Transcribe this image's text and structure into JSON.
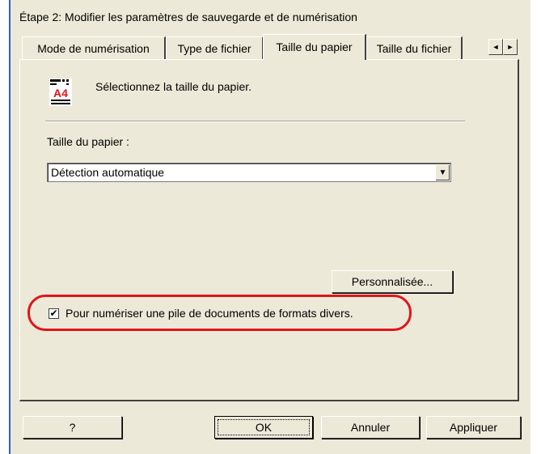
{
  "dialog": {
    "title": "Étape 2: Modifier les paramètres de sauvegarde et de numérisation"
  },
  "tabs": [
    {
      "label": "Mode de numérisation",
      "active": false
    },
    {
      "label": "Type de fichier",
      "active": false
    },
    {
      "label": "Taille du papier",
      "active": true
    },
    {
      "label": "Taille du fichier",
      "active": false
    }
  ],
  "tab_scroll": {
    "left": "◄",
    "right": "►"
  },
  "panel": {
    "icon": "paper-size-icon",
    "icon_text": "A4",
    "instruction": "Sélectionnez la taille du papier.",
    "paper_size_label": "Taille du papier :",
    "paper_size_value": "Détection automatique",
    "dropdown_arrow": "▼",
    "custom_button": "Personnalisée...",
    "mixed_docs_checkbox": {
      "label": "Pour numériser une pile de documents de formats divers.",
      "checked": true,
      "mark": "✔"
    }
  },
  "buttons": {
    "help": "?",
    "ok": "OK",
    "cancel": "Annuler",
    "apply": "Appliquer"
  },
  "colors": {
    "dialog_bg": "#ece9d8",
    "highlight": "#e2141a",
    "accent_bar": "#2a5fd6"
  }
}
